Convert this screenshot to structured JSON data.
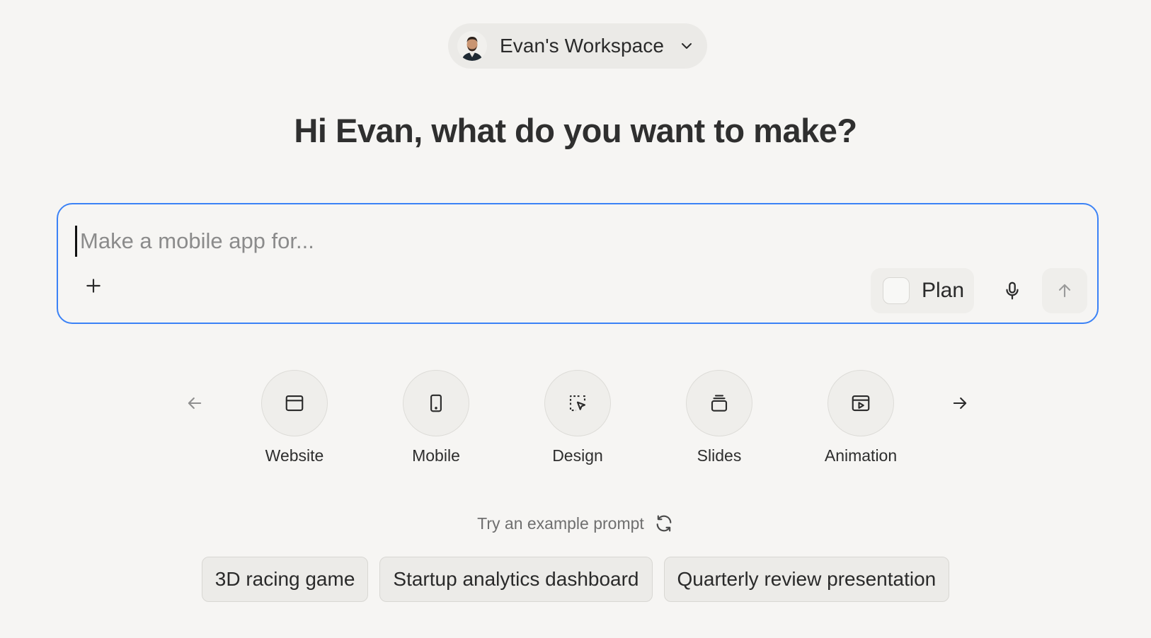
{
  "workspace": {
    "name": "Evan's Workspace",
    "avatar_icon": "user-avatar"
  },
  "headline": "Hi Evan, what do you want to make?",
  "prompt": {
    "placeholder": "Make a mobile app for...",
    "value": "",
    "plan_label": "Plan",
    "accent_color": "#3b82f6"
  },
  "project_types": [
    {
      "label": "Website",
      "icon": "browser-window-icon"
    },
    {
      "label": "Mobile",
      "icon": "mobile-phone-icon"
    },
    {
      "label": "Design",
      "icon": "dashed-cursor-select-icon"
    },
    {
      "label": "Slides",
      "icon": "stacked-slides-icon"
    },
    {
      "label": "Animation",
      "icon": "play-window-icon"
    }
  ],
  "examples": {
    "heading": "Try an example prompt",
    "chips": [
      "3D racing game",
      "Startup analytics dashboard",
      "Quarterly review presentation"
    ]
  }
}
